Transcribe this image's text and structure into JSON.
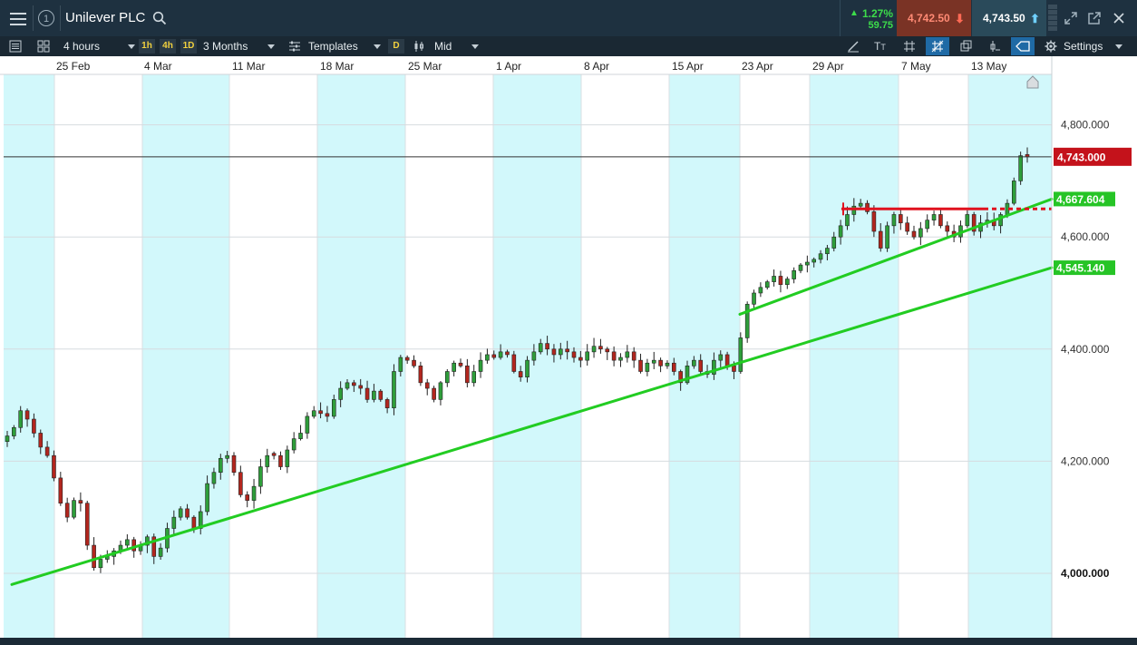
{
  "header": {
    "instrument": "Unilever PLC",
    "info_label": "1",
    "change_pct": "1.27%",
    "change_abs": "59.75",
    "sell_price": "4,742.50",
    "buy_price": "4,743.50"
  },
  "toolbar": {
    "interval": "4 hours",
    "tf_1h": "1h",
    "tf_4h": "4h",
    "tf_1d": "1D",
    "range": "3 Months",
    "templates": "Templates",
    "d_button": "D",
    "price_type": "Mid",
    "settings": "Settings"
  },
  "icons": [
    "menu-icon",
    "info-icon",
    "search-icon",
    "up-arrow-icon",
    "down-arrow-icon",
    "expand-icon",
    "popout-icon",
    "close-icon",
    "list-icon",
    "layout-icon",
    "draw-icon",
    "text-icon",
    "grid-icon",
    "crosshair-icon",
    "layers-icon",
    "indicator-icon",
    "tag-icon",
    "gear-icon",
    "home-icon"
  ],
  "colors": {
    "up": "#2e9e3a",
    "down": "#b3261e",
    "trendline": "#22cc22",
    "resistance": "#e0121f",
    "current_tag": "#c4121b",
    "line_tag": "#26c426",
    "shade": "#d2f8fb"
  },
  "chart_data": {
    "type": "candlestick",
    "interval": "4 hours",
    "range": "3 Months",
    "x_ticks": [
      "25 Feb",
      "4 Mar",
      "11 Mar",
      "18 Mar",
      "25 Mar",
      "1 Apr",
      "8 Apr",
      "15 Apr",
      "23 Apr",
      "29 Apr",
      "7 May",
      "13 May"
    ],
    "y_ticks": [
      4000,
      4200,
      4400,
      4600,
      4800
    ],
    "y_tick_labels": [
      "4,000.000",
      "4,200.000",
      "4,400.000",
      "4,600.000",
      "4,800.000"
    ],
    "ylim": [
      3885,
      4890
    ],
    "current_price": 4743.0,
    "current_price_label": "4,743.000",
    "price_tags": [
      {
        "label": "4,667.604",
        "value": 4667.604
      },
      {
        "label": "4,545.140",
        "value": 4545.14
      }
    ],
    "trendlines": [
      {
        "name": "lower-support",
        "from": {
          "bar": 13,
          "price": 3980
        },
        "to": {
          "bar": 1160,
          "price": 4545.14
        }
      },
      {
        "name": "upper-support",
        "from": {
          "bar": 816,
          "price": 4462
        },
        "to": {
          "bar": 1160,
          "price": 4667.604
        }
      }
    ],
    "resistance": {
      "price": 4650,
      "from": 928,
      "solid_to": 1085,
      "dashed_to": 1160
    },
    "candles_close": [
      4245,
      4260,
      4290,
      4275,
      4250,
      4225,
      4210,
      4170,
      4125,
      4100,
      4130,
      4125,
      4050,
      4010,
      4025,
      4030,
      4040,
      4050,
      4060,
      4040,
      4050,
      4065,
      4030,
      4045,
      4080,
      4100,
      4115,
      4100,
      4080,
      4110,
      4160,
      4180,
      4205,
      4210,
      4180,
      4140,
      4130,
      4155,
      4190,
      4210,
      4210,
      4190,
      4220,
      4240,
      4250,
      4280,
      4290,
      4285,
      4280,
      4310,
      4330,
      4340,
      4335,
      4330,
      4310,
      4325,
      4310,
      4295,
      4360,
      4385,
      4380,
      4370,
      4340,
      4330,
      4310,
      4340,
      4360,
      4375,
      4370,
      4340,
      4360,
      4380,
      4390,
      4385,
      4395,
      4390,
      4360,
      4350,
      4380,
      4395,
      4410,
      4400,
      4390,
      4400,
      4395,
      4385,
      4380,
      4395,
      4405,
      4400,
      4395,
      4380,
      4385,
      4395,
      4380,
      4360,
      4375,
      4380,
      4370,
      4375,
      4360,
      4340,
      4370,
      4380,
      4360,
      4355,
      4380,
      4390,
      4370,
      4360,
      4420,
      4480,
      4500,
      4510,
      4520,
      4530,
      4515,
      4525,
      4540,
      4550,
      4555,
      4560,
      4570,
      4580,
      4600,
      4620,
      4640,
      4655,
      4660,
      4645,
      4610,
      4580,
      4620,
      4640,
      4625,
      4610,
      4600,
      4615,
      4630,
      4640,
      4620,
      4610,
      4600,
      4620,
      4640,
      4610,
      4625,
      4630,
      4620,
      4640,
      4660,
      4700,
      4745,
      4743
    ]
  }
}
